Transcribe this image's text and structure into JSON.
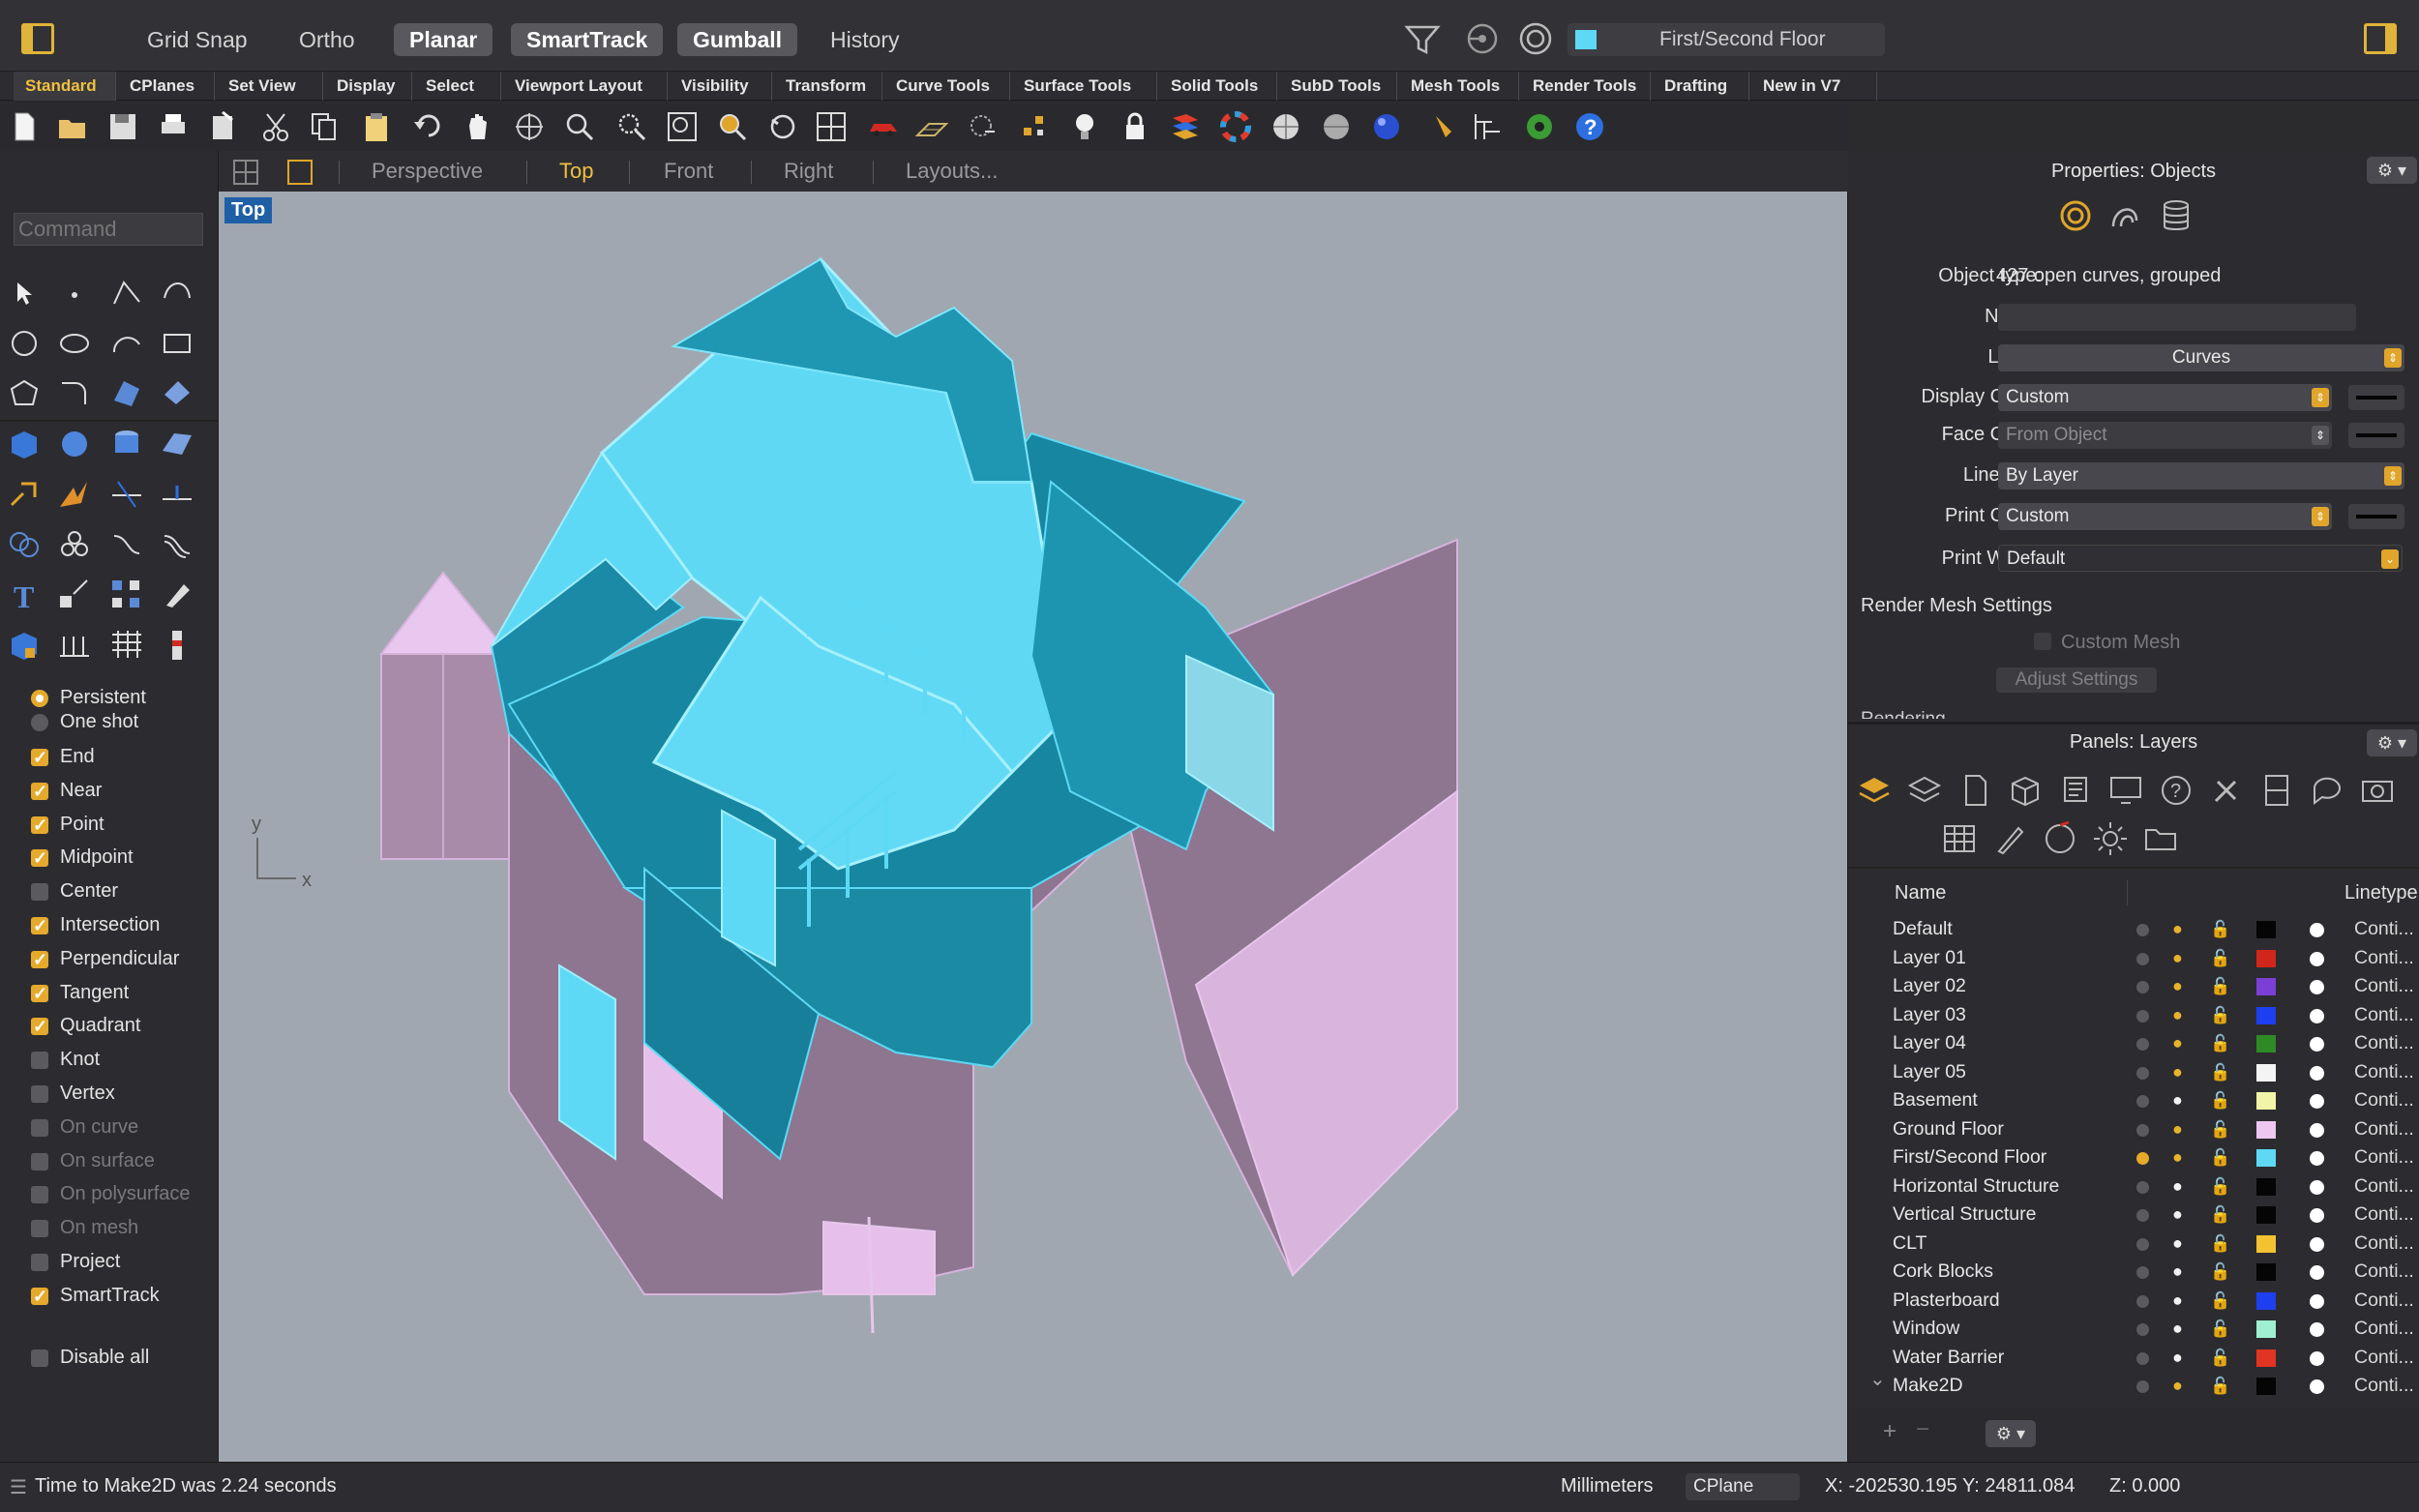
{
  "topbar": {
    "modes": [
      {
        "label": "Grid Snap",
        "on": false
      },
      {
        "label": "Ortho",
        "on": false
      },
      {
        "label": "Planar",
        "on": true
      },
      {
        "label": "SmartTrack",
        "on": true
      },
      {
        "label": "Gumball",
        "on": true
      },
      {
        "label": "History",
        "on": false
      }
    ],
    "current_layer": "First/Second Floor",
    "current_layer_color": "#5ed9f5",
    "icons": [
      "filter-icon",
      "record-history-icon",
      "osnap-icon"
    ]
  },
  "tabs": [
    "Standard",
    "CPlanes",
    "Set View",
    "Display",
    "Select",
    "Viewport Layout",
    "Visibility",
    "Transform",
    "Curve Tools",
    "Surface Tools",
    "Solid Tools",
    "SubD Tools",
    "Mesh Tools",
    "Render Tools",
    "Drafting",
    "New in V7"
  ],
  "active_tab": "Standard",
  "command_placeholder": "Command",
  "viewport": {
    "tabs": [
      "Perspective",
      "Top",
      "Front",
      "Right",
      "Layouts..."
    ],
    "active": "Top",
    "label": "Top",
    "axis_y": "y",
    "axis_x": "x",
    "background": "#a0a7b0"
  },
  "osnaps": {
    "mode": [
      {
        "label": "Persistent",
        "checked": true
      },
      {
        "label": "One shot",
        "checked": false
      }
    ],
    "items": [
      {
        "label": "End",
        "checked": true,
        "enabled": true
      },
      {
        "label": "Near",
        "checked": true,
        "enabled": true
      },
      {
        "label": "Point",
        "checked": true,
        "enabled": true
      },
      {
        "label": "Midpoint",
        "checked": true,
        "enabled": true
      },
      {
        "label": "Center",
        "checked": false,
        "enabled": true
      },
      {
        "label": "Intersection",
        "checked": true,
        "enabled": true
      },
      {
        "label": "Perpendicular",
        "checked": true,
        "enabled": true
      },
      {
        "label": "Tangent",
        "checked": true,
        "enabled": true
      },
      {
        "label": "Quadrant",
        "checked": true,
        "enabled": true
      },
      {
        "label": "Knot",
        "checked": false,
        "enabled": true
      },
      {
        "label": "Vertex",
        "checked": false,
        "enabled": true
      },
      {
        "label": "On curve",
        "checked": false,
        "enabled": false
      },
      {
        "label": "On surface",
        "checked": false,
        "enabled": false
      },
      {
        "label": "On polysurface",
        "checked": false,
        "enabled": false
      },
      {
        "label": "On mesh",
        "checked": false,
        "enabled": false
      },
      {
        "label": "Project",
        "checked": false,
        "enabled": true
      },
      {
        "label": "SmartTrack",
        "checked": true,
        "enabled": true
      }
    ],
    "disable_all": {
      "label": "Disable all",
      "checked": false
    }
  },
  "properties": {
    "title": "Properties: Objects",
    "object_type_label": "Object type:",
    "object_type": "427 open curves, grouped",
    "name_label": "Name:",
    "name_value": "",
    "layer_label": "Layer:",
    "layer_value": "Curves",
    "display_color_label": "Display Color:",
    "display_color_value": "Custom",
    "face_color_label": "Face Color:",
    "face_color_value": "From Object",
    "linetype_label": "Linetype:",
    "linetype_value": "By Layer",
    "print_color_label": "Print Color:",
    "print_color_value": "Custom",
    "print_width_label": "Print Width:",
    "print_width_value": "Default",
    "render_mesh_settings": "Render Mesh Settings",
    "custom_mesh": "Custom Mesh",
    "adjust_settings": "Adjust Settings",
    "rendering_cut": "Rendering"
  },
  "layers_panel": {
    "title": "Panels: Layers",
    "col_name": "Name",
    "col_linetype": "Linetype",
    "rows": [
      {
        "name": "Default",
        "current": false,
        "bulb_on": true,
        "color": "#050505",
        "linetype": "Conti..."
      },
      {
        "name": "Layer 01",
        "current": false,
        "bulb_on": true,
        "color": "#d1261b",
        "linetype": "Conti..."
      },
      {
        "name": "Layer 02",
        "current": false,
        "bulb_on": true,
        "color": "#7c3fd6",
        "linetype": "Conti..."
      },
      {
        "name": "Layer 03",
        "current": false,
        "bulb_on": true,
        "color": "#1e3ff0",
        "linetype": "Conti..."
      },
      {
        "name": "Layer 04",
        "current": false,
        "bulb_on": true,
        "color": "#2e8a25",
        "linetype": "Conti..."
      },
      {
        "name": "Layer 05",
        "current": false,
        "bulb_on": true,
        "color": "#f4f4f4",
        "linetype": "Conti..."
      },
      {
        "name": "Basement",
        "current": false,
        "bulb_on": false,
        "color": "#f2f5a8",
        "linetype": "Conti..."
      },
      {
        "name": "Ground Floor",
        "current": false,
        "bulb_on": true,
        "color": "#eec7f0",
        "linetype": "Conti..."
      },
      {
        "name": "First/Second Floor",
        "current": true,
        "bulb_on": true,
        "color": "#5ed9f5",
        "linetype": "Conti..."
      },
      {
        "name": "Horizontal Structure",
        "current": false,
        "bulb_on": false,
        "color": "#050505",
        "linetype": "Conti..."
      },
      {
        "name": "Vertical Structure",
        "current": false,
        "bulb_on": false,
        "color": "#050505",
        "linetype": "Conti..."
      },
      {
        "name": "CLT",
        "current": false,
        "bulb_on": false,
        "color": "#f2c230",
        "linetype": "Conti..."
      },
      {
        "name": "Cork Blocks",
        "current": false,
        "bulb_on": false,
        "color": "#050505",
        "linetype": "Conti..."
      },
      {
        "name": "Plasterboard",
        "current": false,
        "bulb_on": false,
        "color": "#1e3ff0",
        "linetype": "Conti..."
      },
      {
        "name": "Window",
        "current": false,
        "bulb_on": false,
        "color": "#9ff0d2",
        "linetype": "Conti..."
      },
      {
        "name": "Water Barrier",
        "current": false,
        "bulb_on": false,
        "color": "#e23422",
        "linetype": "Conti..."
      },
      {
        "name": "Make2D",
        "current": false,
        "bulb_on": true,
        "color": "#050505",
        "linetype": "Conti..."
      }
    ]
  },
  "status": {
    "message": "Time to Make2D was 2.24 seconds",
    "units": "Millimeters",
    "cplane": "CPlane",
    "coords": "X: -202530.195 Y: 24811.084",
    "z": "Z: 0.000"
  },
  "colors": {
    "accent": "#e5a92b",
    "model_cyan": "#5ed9f5",
    "model_dark_cyan": "#1a8aa6",
    "model_pink": "#d9b4dd"
  }
}
